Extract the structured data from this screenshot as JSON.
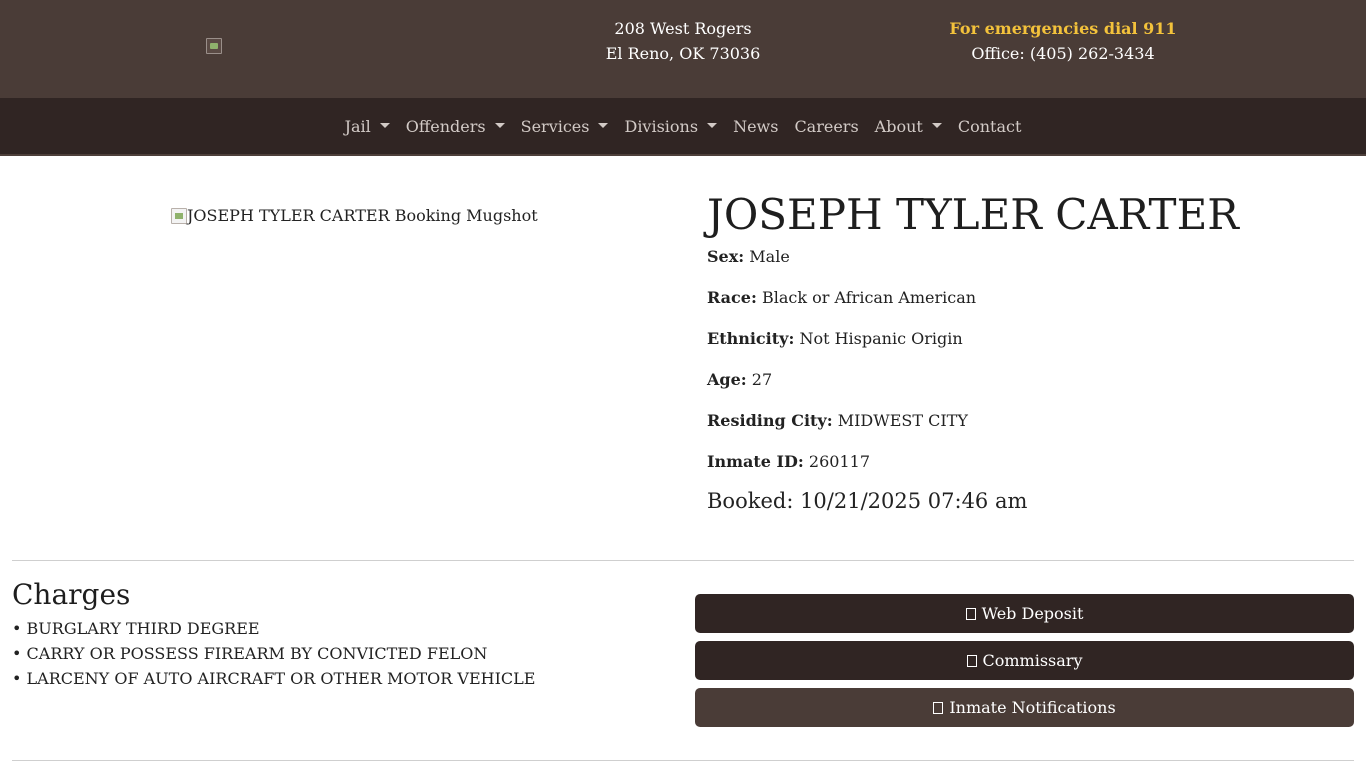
{
  "header": {
    "logo_icon": "broken-image-icon",
    "address_line1": "208 West Rogers",
    "address_line2": "El Reno, OK 73036",
    "emergency_text": "For emergencies dial 911",
    "office_phone": "Office: (405) 262-3434",
    "colors": {
      "topbar_bg": "#4a3c37",
      "emergency": "#f3c23b"
    }
  },
  "nav": {
    "items": [
      {
        "label": "Jail",
        "dropdown": true
      },
      {
        "label": "Offenders",
        "dropdown": true
      },
      {
        "label": "Services",
        "dropdown": true
      },
      {
        "label": "Divisions",
        "dropdown": true
      },
      {
        "label": "News",
        "dropdown": false
      },
      {
        "label": "Careers",
        "dropdown": false
      },
      {
        "label": "About",
        "dropdown": true
      },
      {
        "label": "Contact",
        "dropdown": false
      }
    ],
    "colors": {
      "navbar_bg": "#302523"
    }
  },
  "inmate": {
    "mugshot_alt": "JOSEPH TYLER CARTER Booking Mugshot",
    "name": "JOSEPH TYLER CARTER",
    "fields": [
      {
        "label": "Sex:",
        "value": "Male"
      },
      {
        "label": "Race:",
        "value": "Black or African American"
      },
      {
        "label": "Ethnicity:",
        "value": "Not Hispanic Origin"
      },
      {
        "label": "Age:",
        "value": "27"
      },
      {
        "label": "Residing City:",
        "value": "MIDWEST CITY"
      },
      {
        "label": "Inmate ID:",
        "value": "260117"
      }
    ],
    "booked": "Booked: 10/21/2025 07:46 am"
  },
  "charges": {
    "heading": "Charges",
    "items": [
      "• BURGLARY THIRD DEGREE",
      "• CARRY OR POSSESS FIREARM BY CONVICTED FELON",
      "• LARCENY OF AUTO AIRCRAFT OR OTHER MOTOR VEHICLE"
    ]
  },
  "actions": {
    "buttons": [
      {
        "label": "Web Deposit",
        "icon": "missing-glyph-icon"
      },
      {
        "label": "Commissary",
        "icon": "missing-glyph-icon"
      },
      {
        "label": "Inmate Notifications",
        "icon": "missing-glyph-icon"
      }
    ]
  }
}
